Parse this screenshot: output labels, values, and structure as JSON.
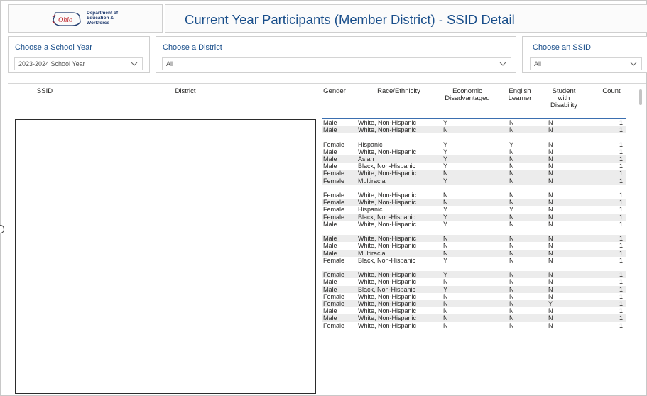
{
  "header": {
    "logo_lines": [
      "Department of",
      "Education &",
      "Workforce"
    ],
    "logo_word": "Ohio",
    "title": "Current Year Participants (Member District) - SSID Detail"
  },
  "filters": {
    "school_year": {
      "label": "Choose a School Year",
      "value": "2023-2024 School Year"
    },
    "district": {
      "label": "Choose a District",
      "value": "All"
    },
    "ssid": {
      "label": "Choose an SSID",
      "value": "All"
    }
  },
  "table": {
    "columns": {
      "ssid": "SSID",
      "district": "District",
      "gender": "Gender",
      "race": "Race/Ethnicity",
      "econ": "Economic Disadvantaged",
      "english": "English Learner",
      "swd": "Student with Disability",
      "count": "Count"
    },
    "rows": [
      {
        "gender": "Male",
        "race": "White, Non-Hispanic",
        "econ": "Y",
        "eng": "N",
        "swd": "N",
        "count": "1"
      },
      {
        "gender": "Male",
        "race": "White, Non-Hispanic",
        "econ": "N",
        "eng": "N",
        "swd": "N",
        "count": "1"
      },
      {
        "gender": "",
        "race": "",
        "econ": "",
        "eng": "",
        "swd": "",
        "count": ""
      },
      {
        "gender": "Female",
        "race": "Hispanic",
        "econ": "Y",
        "eng": "Y",
        "swd": "N",
        "count": "1"
      },
      {
        "gender": "Male",
        "race": "White, Non-Hispanic",
        "econ": "Y",
        "eng": "N",
        "swd": "N",
        "count": "1"
      },
      {
        "gender": "Male",
        "race": "Asian",
        "econ": "Y",
        "eng": "N",
        "swd": "N",
        "count": "1"
      },
      {
        "gender": "Male",
        "race": "Black, Non-Hispanic",
        "econ": "Y",
        "eng": "N",
        "swd": "N",
        "count": "1"
      },
      {
        "gender": "Female",
        "race": "White, Non-Hispanic",
        "econ": "N",
        "eng": "N",
        "swd": "N",
        "count": "1"
      },
      {
        "gender": "Female",
        "race": "Multiracial",
        "econ": "Y",
        "eng": "N",
        "swd": "N",
        "count": "1"
      },
      {
        "gender": "",
        "race": "",
        "econ": "",
        "eng": "",
        "swd": "",
        "count": ""
      },
      {
        "gender": "Female",
        "race": "White, Non-Hispanic",
        "econ": "N",
        "eng": "N",
        "swd": "N",
        "count": "1"
      },
      {
        "gender": "Female",
        "race": "White, Non-Hispanic",
        "econ": "N",
        "eng": "N",
        "swd": "N",
        "count": "1"
      },
      {
        "gender": "Female",
        "race": "Hispanic",
        "econ": "Y",
        "eng": "Y",
        "swd": "N",
        "count": "1"
      },
      {
        "gender": "Female",
        "race": "Black, Non-Hispanic",
        "econ": "Y",
        "eng": "N",
        "swd": "N",
        "count": "1"
      },
      {
        "gender": "Male",
        "race": "White, Non-Hispanic",
        "econ": "Y",
        "eng": "N",
        "swd": "N",
        "count": "1"
      },
      {
        "gender": "",
        "race": "",
        "econ": "",
        "eng": "",
        "swd": "",
        "count": ""
      },
      {
        "gender": "Male",
        "race": "White, Non-Hispanic",
        "econ": "N",
        "eng": "N",
        "swd": "N",
        "count": "1"
      },
      {
        "gender": "Male",
        "race": "White, Non-Hispanic",
        "econ": "N",
        "eng": "N",
        "swd": "N",
        "count": "1"
      },
      {
        "gender": "Male",
        "race": "Multiracial",
        "econ": "N",
        "eng": "N",
        "swd": "N",
        "count": "1"
      },
      {
        "gender": "Female",
        "race": "Black, Non-Hispanic",
        "econ": "Y",
        "eng": "N",
        "swd": "N",
        "count": "1"
      },
      {
        "gender": "",
        "race": "",
        "econ": "",
        "eng": "",
        "swd": "",
        "count": ""
      },
      {
        "gender": "Female",
        "race": "White, Non-Hispanic",
        "econ": "Y",
        "eng": "N",
        "swd": "N",
        "count": "1"
      },
      {
        "gender": "Male",
        "race": "White, Non-Hispanic",
        "econ": "N",
        "eng": "N",
        "swd": "N",
        "count": "1"
      },
      {
        "gender": "Male",
        "race": "Black, Non-Hispanic",
        "econ": "Y",
        "eng": "N",
        "swd": "N",
        "count": "1"
      },
      {
        "gender": "Female",
        "race": "White, Non-Hispanic",
        "econ": "N",
        "eng": "N",
        "swd": "N",
        "count": "1"
      },
      {
        "gender": "Female",
        "race": "White, Non-Hispanic",
        "econ": "N",
        "eng": "N",
        "swd": "Y",
        "count": "1"
      },
      {
        "gender": "Male",
        "race": "White, Non-Hispanic",
        "econ": "N",
        "eng": "N",
        "swd": "N",
        "count": "1"
      },
      {
        "gender": "Male",
        "race": "White, Non-Hispanic",
        "econ": "N",
        "eng": "N",
        "swd": "N",
        "count": "1"
      },
      {
        "gender": "Female",
        "race": "White, Non-Hispanic",
        "econ": "N",
        "eng": "N",
        "swd": "N",
        "count": "1"
      }
    ]
  },
  "colors": {
    "title_blue": "#1a4f8b",
    "row_shade": "#ececec",
    "border_dark": "#2b2b2b"
  }
}
